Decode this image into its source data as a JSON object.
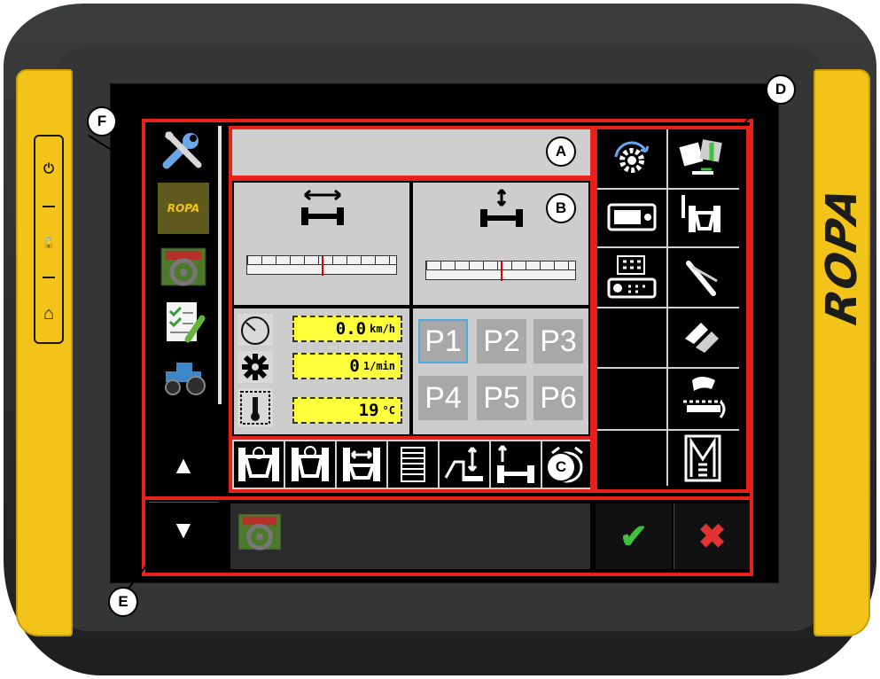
{
  "device": {
    "brand_logo": "ROPA"
  },
  "hardware_buttons": [
    {
      "icon": "power-icon",
      "glyph": "⏻"
    },
    {
      "icon": "unlock-icon",
      "glyph": "🔓"
    },
    {
      "icon": "home-icon",
      "glyph": "⌂"
    }
  ],
  "left_nav": {
    "items": [
      {
        "icon": "tools-icon"
      },
      {
        "icon": "ropa-logo-icon",
        "label": "ROPA"
      },
      {
        "icon": "steering-wheel-icon"
      },
      {
        "icon": "checklist-icon"
      },
      {
        "icon": "tractor-icon"
      }
    ],
    "up_arrow": "▲",
    "down_arrow": "▼"
  },
  "panel_b": {
    "speed": {
      "value": "0.0",
      "unit": "km/h",
      "icon": "speedometer-icon"
    },
    "rpm": {
      "value": "0",
      "unit": "1/min",
      "icon": "engine-icon"
    },
    "temperature": {
      "value": "19",
      "unit": "°C",
      "icon": "coolant-temperature-icon"
    },
    "track_width_gauge": {
      "icon": "track-width-icon",
      "level": 0.5
    },
    "height_gauge": {
      "icon": "height-adjust-icon",
      "level": 0.5
    },
    "presets": [
      "P1",
      "P2",
      "P3",
      "P4",
      "P5",
      "P6"
    ],
    "active_preset": "P1"
  },
  "panel_c": {
    "buttons": [
      {
        "icon": "front-axle-icon"
      },
      {
        "icon": "rear-axle-icon"
      },
      {
        "icon": "axle-width-icon"
      },
      {
        "icon": "grid-icon"
      },
      {
        "icon": "raise-lower-icon"
      },
      {
        "icon": "height-axle-icon"
      },
      {
        "icon": "alarm-icon"
      }
    ]
  },
  "panel_d": {
    "buttons": [
      {
        "icon": "settings-rotate-icon"
      },
      {
        "icon": "field-transfer-icon"
      },
      {
        "icon": "terminal-icon"
      },
      {
        "icon": "rear-axle-detail-icon"
      },
      {
        "icon": "keypad-display-icon"
      },
      {
        "icon": "knife-icon"
      },
      {
        "icon": "empty-slot-icon"
      },
      {
        "icon": "conveyor-chevron-icon"
      },
      {
        "icon": "empty-slot-icon"
      },
      {
        "icon": "hand-sensor-icon"
      },
      {
        "icon": "empty-slot-icon"
      },
      {
        "icon": "memory-m-icon"
      }
    ]
  },
  "bottom_bar": {
    "message_icon": "steering-wheel-icon",
    "confirm_glyph": "✔",
    "cancel_glyph": "✖",
    "confirm_color": "#3fbf3f",
    "cancel_color": "#e23131"
  },
  "callouts": [
    "A",
    "B",
    "C",
    "D",
    "E",
    "F"
  ],
  "colors": {
    "highlight": "#e8201a",
    "readout": "#ffff3c",
    "device_yellow": "#f2c41a"
  }
}
